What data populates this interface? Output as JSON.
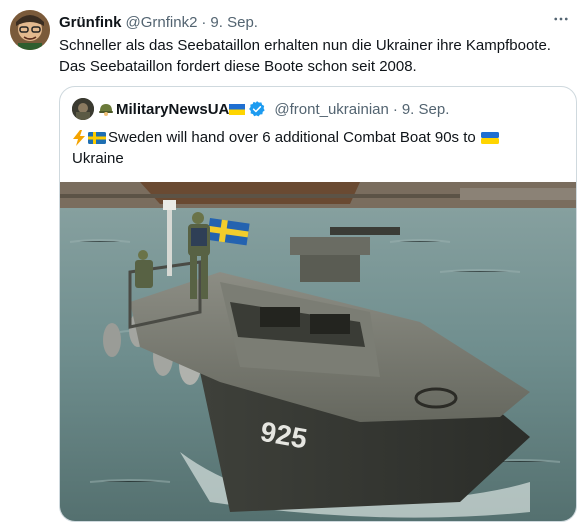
{
  "tweet": {
    "author_name": "Grünfink",
    "author_handle": "@Grnfink2",
    "separator": "·",
    "date": "9. Sep.",
    "text_line1": "Schneller als das Seebataillon erhalten nun die Ukrainer ihre Kampfboote.",
    "text_line2": "Das Seebataillon fordert diese Boote schon seit 2008.",
    "more_icon": "more-horizontal-icon"
  },
  "quote": {
    "author_name": "MilitaryNewsUA",
    "author_handle": "@front_ukrainian",
    "separator": "·",
    "date": "9. Sep.",
    "text_line1": "Sweden will hand over 6 additional Combat Boat 90s to",
    "text_line2": "Ukraine",
    "hull_number": "925",
    "verified_icon": "verified-badge-icon"
  },
  "colors": {
    "text_primary": "#0f1419",
    "text_secondary": "#536471",
    "border": "#cfd9de",
    "verified": "#1d9bf0",
    "boat_hull": "#4a4d45",
    "water": "#6f8e8e"
  }
}
